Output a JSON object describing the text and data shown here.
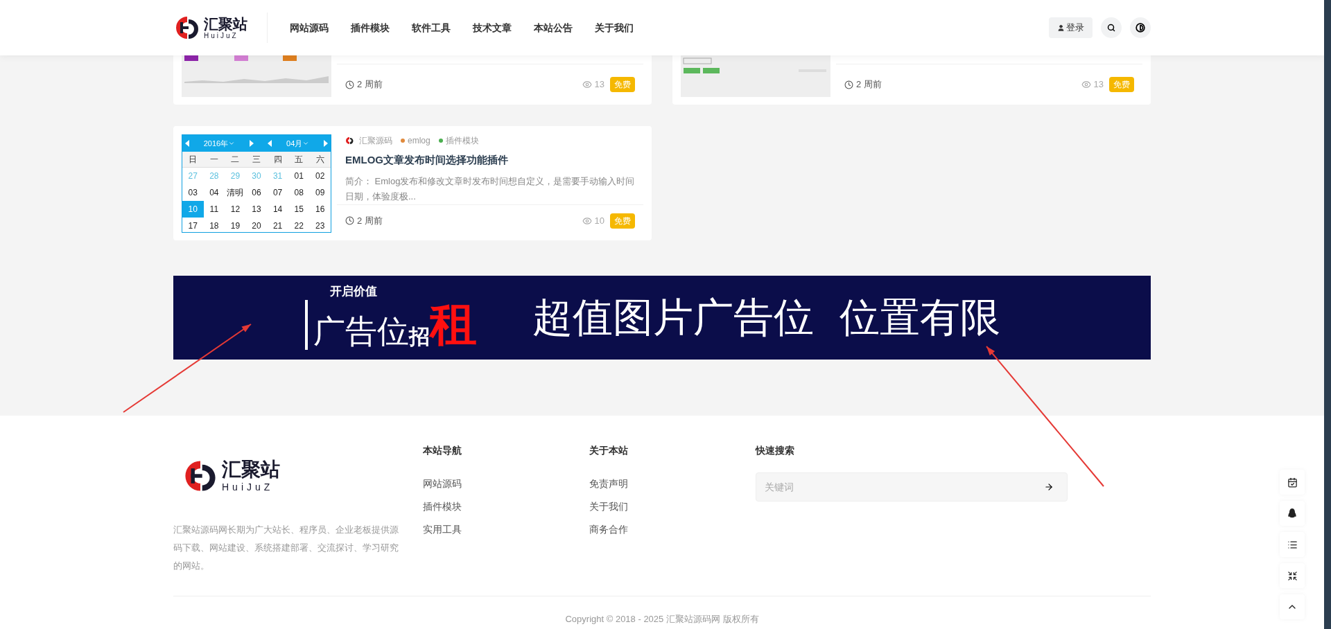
{
  "header": {
    "logo": {
      "text": "汇聚站",
      "subtitle": "HuiJuZ"
    },
    "nav": [
      "网站源码",
      "插件模块",
      "软件工具",
      "技术文章",
      "本站公告",
      "关于我们"
    ],
    "login": "登录"
  },
  "top_posts": [
    {
      "time": "2 周前",
      "views": "13",
      "badge": "免费"
    },
    {
      "time": "2 周前",
      "views": "13",
      "badge": "免费"
    }
  ],
  "post": {
    "calendar": {
      "year": "2016年",
      "month": "04月",
      "weekdays": [
        "日",
        "一",
        "二",
        "三",
        "四",
        "五",
        "六"
      ],
      "weeks": [
        [
          {
            "day": "27",
            "muted": true,
            "selected": false
          },
          {
            "day": "28",
            "muted": true,
            "selected": false
          },
          {
            "day": "29",
            "muted": true,
            "selected": false
          },
          {
            "day": "30",
            "muted": true,
            "selected": false
          },
          {
            "day": "31",
            "muted": true,
            "selected": false
          },
          {
            "day": "01",
            "muted": false,
            "selected": false
          },
          {
            "day": "02",
            "muted": false,
            "selected": false
          }
        ],
        [
          {
            "day": "03",
            "muted": false,
            "selected": false
          },
          {
            "day": "04",
            "muted": false,
            "selected": false
          },
          {
            "day": "清明",
            "muted": false,
            "selected": false
          },
          {
            "day": "06",
            "muted": false,
            "selected": false
          },
          {
            "day": "07",
            "muted": false,
            "selected": false
          },
          {
            "day": "08",
            "muted": false,
            "selected": false
          },
          {
            "day": "09",
            "muted": false,
            "selected": false
          }
        ],
        [
          {
            "day": "10",
            "muted": false,
            "selected": true
          },
          {
            "day": "11",
            "muted": false,
            "selected": false
          },
          {
            "day": "12",
            "muted": false,
            "selected": false
          },
          {
            "day": "13",
            "muted": false,
            "selected": false
          },
          {
            "day": "14",
            "muted": false,
            "selected": false
          },
          {
            "day": "15",
            "muted": false,
            "selected": false
          },
          {
            "day": "16",
            "muted": false,
            "selected": false
          }
        ],
        [
          {
            "day": "17",
            "muted": false,
            "selected": false
          },
          {
            "day": "18",
            "muted": false,
            "selected": false
          },
          {
            "day": "19",
            "muted": false,
            "selected": false
          },
          {
            "day": "20",
            "muted": false,
            "selected": false
          },
          {
            "day": "21",
            "muted": false,
            "selected": false
          },
          {
            "day": "22",
            "muted": false,
            "selected": false
          },
          {
            "day": "23",
            "muted": false,
            "selected": false
          }
        ]
      ]
    },
    "author": "汇聚源码",
    "tags": [
      {
        "label": "emlog",
        "color": "#e08a3c"
      },
      {
        "label": "插件模块",
        "color": "#4caf50"
      }
    ],
    "title": "EMLOG文章发布时间选择功能插件",
    "excerpt": "简介： Emlog发布和修改文章时发布时间想自定义，是需要手动输入时间日期，体验度极...",
    "time": "2 周前",
    "views": "10",
    "badge": "免费"
  },
  "banner": {
    "small": "开启价值",
    "main": "广告位",
    "zhao": "招",
    "zu": "租",
    "slogan": "超值图片广告位  位置有限"
  },
  "footer": {
    "logo": {
      "text": "汇聚站",
      "subtitle": "HuiJuZ"
    },
    "description": "汇聚站源码网长期为广大站长、程序员、企业老板提供源码下载、网站建设、系统搭建部署、交流探讨、学习研究的网站。",
    "columns": [
      {
        "title": "本站导航",
        "links": [
          "网站源码",
          "插件模块",
          "实用工具"
        ]
      },
      {
        "title": "关于本站",
        "links": [
          "免责声明",
          "关于我们",
          "商务合作"
        ]
      }
    ],
    "search": {
      "title": "快速搜索",
      "placeholder": "关键词"
    },
    "copyright": "Copyright © 2018 - 2025 汇聚站源码网 版权所有"
  }
}
